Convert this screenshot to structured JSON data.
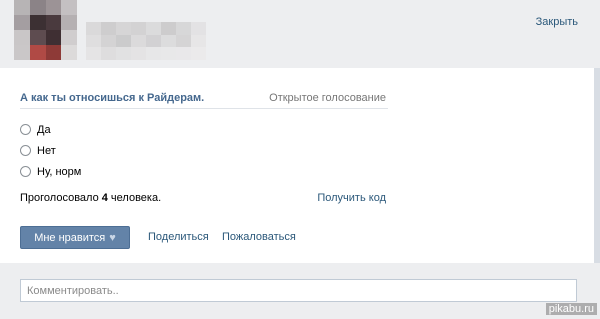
{
  "header": {
    "close_label": "Закрыть"
  },
  "poll": {
    "title": "А как ты относишься к Райдерам.",
    "type_label": "Открытое голосование",
    "options": [
      "Да",
      "Нет",
      "Ну, норм"
    ],
    "votes_prefix": "Проголосовало ",
    "votes_count": "4",
    "votes_suffix": " человека.",
    "get_code_label": "Получить код"
  },
  "actions": {
    "like_label": "Мне нравится",
    "share_label": "Поделиться",
    "report_label": "Пожаловаться"
  },
  "comment": {
    "placeholder": "Комментировать.."
  },
  "watermark": "pikabu.ru",
  "colors": {
    "header_bg": "#edeef0",
    "link": "#2b587a",
    "title": "#45688e",
    "button_bg": "#6383a8"
  },
  "icons": {
    "like": "heart-icon"
  }
}
